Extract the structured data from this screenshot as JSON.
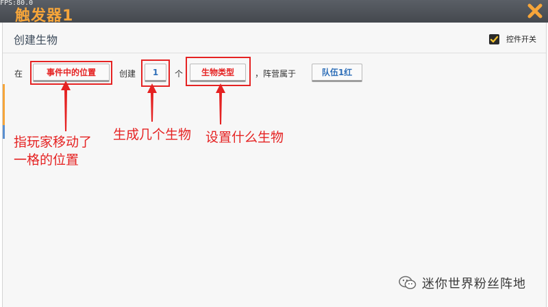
{
  "titlebar": {
    "fps": "FPS:80.0",
    "title": "触发器1"
  },
  "header": {
    "section_title": "创建生物",
    "toggle_label": "控件开关",
    "toggle_checked": true
  },
  "action": {
    "at_label": "在",
    "position_button": "事件中的位置",
    "create_label": "创建",
    "count_button": "1",
    "unit_label": "个",
    "creature_button": "生物类型",
    "faction_label": "，阵营属于",
    "team_button": "队伍1红"
  },
  "annotations": {
    "position_note_line1": "指玩家移动了",
    "position_note_line2": "一格的位置",
    "count_note": "生成几个生物",
    "creature_note": "设置什么生物"
  },
  "watermark": {
    "text": "迷你世界粉丝阵地"
  },
  "colors": {
    "accent_orange": "#f6a53a",
    "annotation_red": "#e52222",
    "button_blue_text": "#2f6fb8"
  }
}
